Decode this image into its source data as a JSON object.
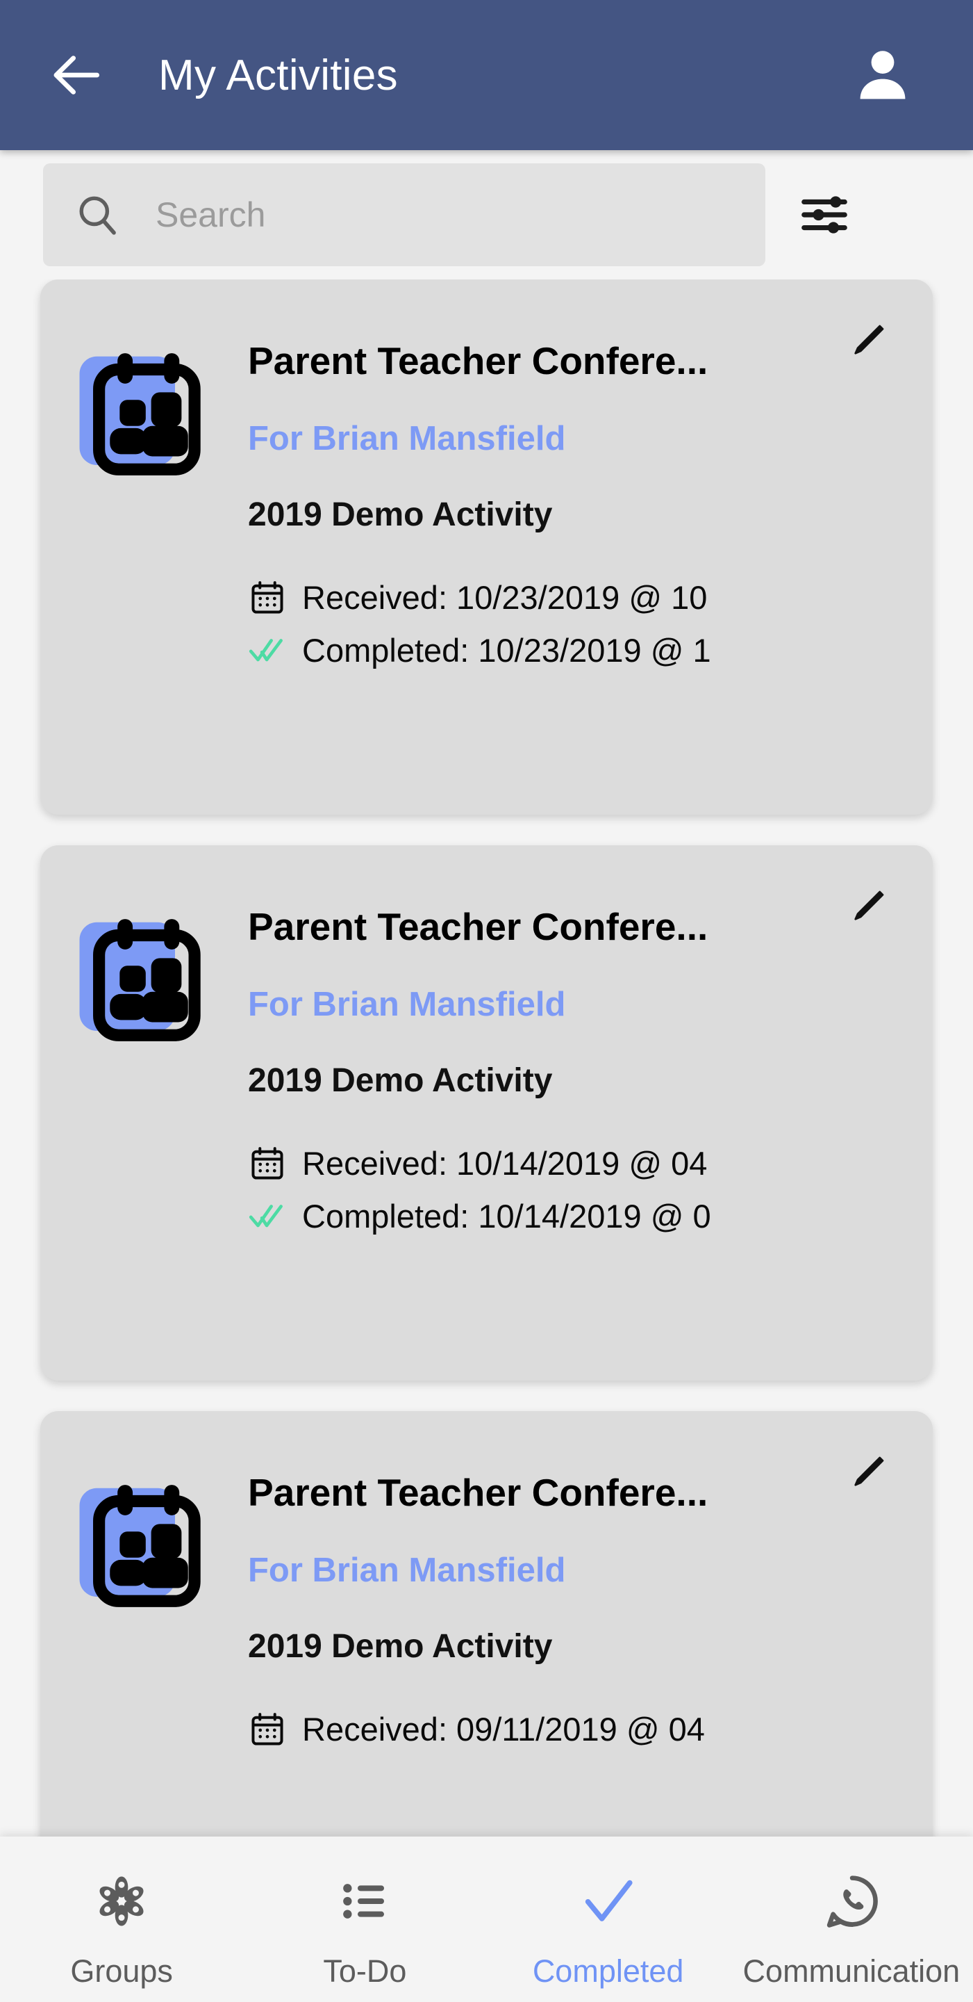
{
  "theme": {
    "appbar_bg": "#445583",
    "page_bg": "#f4f4f4",
    "card_bg": "#dcdcdc",
    "accent_blue": "#7d9af5",
    "active_nav": "#6f93f5",
    "check_green": "#4ddba4",
    "icon_blue": "#7d9af5",
    "placeholder_gray": "#9b9b9b"
  },
  "header": {
    "title": "My Activities",
    "back_icon": "arrow-left-icon",
    "account_icon": "person-icon"
  },
  "search": {
    "placeholder": "Search",
    "value": "",
    "search_icon": "search-icon",
    "filter_icon": "sliders-filter-icon"
  },
  "cards": [
    {
      "icon": "calendar-people-icon",
      "title": "Parent Teacher Confere...",
      "subtitle": "For Brian Mansfield",
      "activity": "2019 Demo Activity",
      "received_label": "Received: 10/23/2019 @ 10",
      "completed_label": "Completed: 10/23/2019 @ 1",
      "received_icon": "calendar-icon",
      "completed_icon": "double-check-icon",
      "edit_icon": "pencil-edit-icon"
    },
    {
      "icon": "calendar-people-icon",
      "title": "Parent Teacher Confere...",
      "subtitle": "For Brian Mansfield",
      "activity": "2019 Demo Activity",
      "received_label": "Received: 10/14/2019 @ 04",
      "completed_label": "Completed: 10/14/2019 @ 0",
      "received_icon": "calendar-icon",
      "completed_icon": "double-check-icon",
      "edit_icon": "pencil-edit-icon"
    },
    {
      "icon": "calendar-people-icon",
      "title": "Parent Teacher Confere...",
      "subtitle": "For Brian Mansfield",
      "activity": "2019 Demo Activity",
      "received_label": "Received: 09/11/2019 @ 04",
      "completed_label": "",
      "received_icon": "calendar-icon",
      "completed_icon": "double-check-icon",
      "edit_icon": "pencil-edit-icon"
    }
  ],
  "bottom_nav": {
    "items": [
      {
        "label": "Groups",
        "icon": "flower-groups-icon",
        "active": false
      },
      {
        "label": "To-Do",
        "icon": "list-todo-icon",
        "active": false
      },
      {
        "label": "Completed",
        "icon": "check-icon",
        "active": true
      },
      {
        "label": "Communication",
        "icon": "chat-phone-icon",
        "active": false
      }
    ]
  }
}
